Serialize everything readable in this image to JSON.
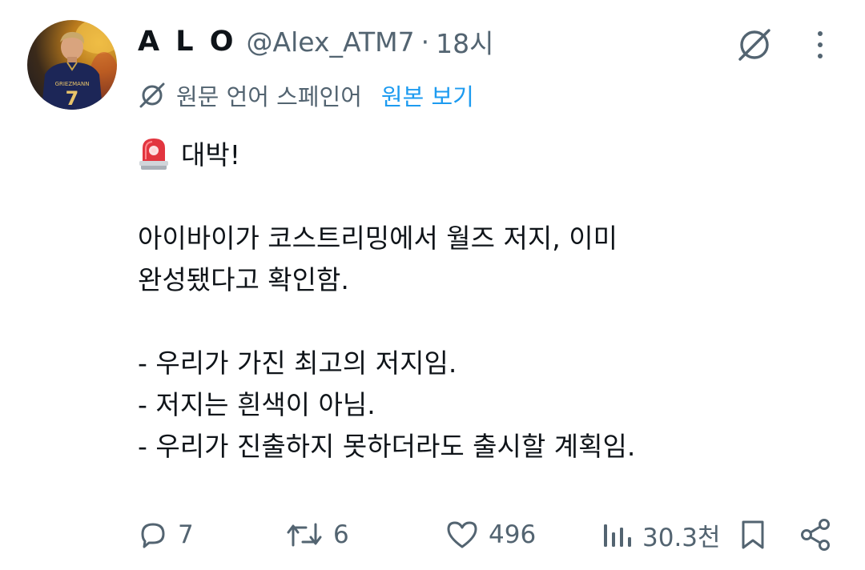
{
  "author": {
    "name": "A L O",
    "handle": "@Alex_ATM7",
    "separator": "·",
    "time": "18시",
    "avatar_jersey_text": "GRIEZMANN",
    "avatar_jersey_number": "7"
  },
  "translation": {
    "note": "원문 언어 스페인어",
    "show_original": "원본 보기"
  },
  "tweet": {
    "lines": [
      "대박!",
      "",
      "아이바이가 코스트리밍에서 월즈 저지, 이미",
      "완성됐다고 확인함.",
      "",
      "- 우리가 가진 최고의 저지임.",
      "- 저지는 흰색이 아님.",
      "- 우리가 진출하지 못하더라도 출시할 계획임."
    ]
  },
  "actions": {
    "replies": "7",
    "retweets": "6",
    "likes": "496",
    "views": "30.3천"
  },
  "colors": {
    "text": "#0f1419",
    "secondary": "#536471",
    "link": "#1d9bf0"
  },
  "icons": [
    "grok-icon",
    "more-icon",
    "translate-icon",
    "siren-emoji",
    "reply-icon",
    "retweet-icon",
    "like-icon",
    "views-icon",
    "bookmark-icon",
    "share-icon"
  ]
}
